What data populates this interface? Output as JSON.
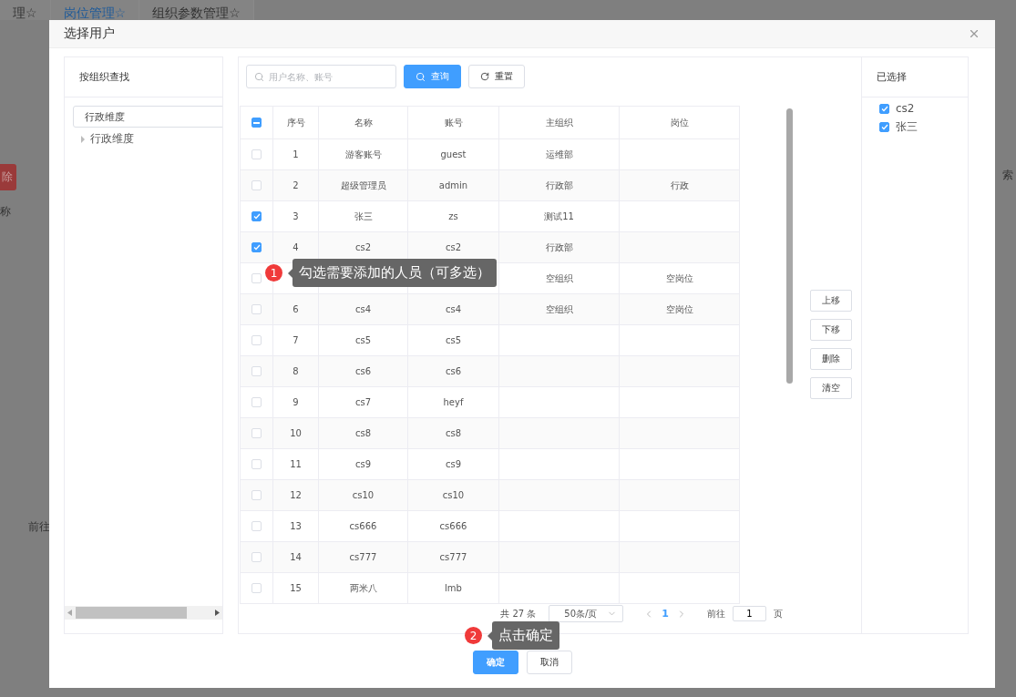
{
  "background": {
    "tabs": [
      {
        "label": "理☆",
        "selected": false
      },
      {
        "label": "岗位管理☆",
        "selected": true
      },
      {
        "label": "组织参数管理☆",
        "selected": false
      }
    ],
    "delete_button": "除",
    "column_header": "称",
    "pager_goto": "前往",
    "side_text": "索"
  },
  "dialog": {
    "title": "选择用户",
    "org_panel": {
      "title": "按组织查找",
      "field_value": "行政维度",
      "tree": [
        {
          "label": "行政维度",
          "expanded": false
        }
      ]
    },
    "search": {
      "placeholder": "用户名称、账号",
      "query_button": "查询",
      "reset_button": "重置"
    },
    "table": {
      "select_all_indeterminate": true,
      "columns": [
        "序号",
        "名称",
        "账号",
        "主组织",
        "岗位"
      ],
      "rows": [
        {
          "seq": "1",
          "name": "游客账号",
          "account": "guest",
          "org": "运维部",
          "checked": false
        },
        {
          "seq": "2",
          "name": "超级管理员",
          "account": "admin",
          "org": "行政部",
          "post": "行政",
          "checked": false
        },
        {
          "seq": "3",
          "name": "张三",
          "account": "zs",
          "org": "测试11",
          "checked": true
        },
        {
          "seq": "4",
          "name": "cs2",
          "account": "cs2",
          "org": "行政部",
          "checked": true
        },
        {
          "org": "空组织",
          "post": "空岗位",
          "checked": false
        },
        {
          "seq": "6",
          "name": "cs4",
          "account": "cs4",
          "org": "空组织",
          "post": "空岗位",
          "checked": false
        },
        {
          "seq": "7",
          "name": "cs5",
          "account": "cs5",
          "checked": false
        },
        {
          "seq": "8",
          "name": "cs6",
          "account": "cs6",
          "checked": false
        },
        {
          "seq": "9",
          "name": "cs7",
          "account": "heyf",
          "checked": false
        },
        {
          "seq": "10",
          "name": "cs8",
          "account": "cs8",
          "checked": false
        },
        {
          "seq": "11",
          "name": "cs9",
          "account": "cs9",
          "checked": false
        },
        {
          "seq": "12",
          "name": "cs10",
          "account": "cs10",
          "checked": false
        },
        {
          "seq": "13",
          "name": "cs666",
          "account": "cs666",
          "checked": false
        },
        {
          "seq": "14",
          "name": "cs777",
          "account": "cs777",
          "checked": false
        },
        {
          "seq": "15",
          "name": "两米八",
          "account": "lmb",
          "checked": false
        }
      ]
    },
    "pagination": {
      "total": "共 27 条",
      "page_size": "50条/页",
      "pages": [
        {
          "label": "1",
          "selected": true
        }
      ],
      "goto_label": "前往",
      "goto_value": "1",
      "goto_unit": "页"
    },
    "move_buttons": [
      "上移",
      "下移",
      "删除",
      "清空"
    ],
    "selected_panel": {
      "title": "已选择",
      "items": [
        {
          "label": "cs2",
          "checked": true
        },
        {
          "label": "张三",
          "checked": true
        }
      ]
    },
    "confirm_button": "确定",
    "cancel_button": "取消"
  },
  "tips": [
    {
      "number": "1",
      "text": "勾选需要添加的人员（可多选）"
    },
    {
      "number": "2",
      "text": "点击确定"
    }
  ]
}
